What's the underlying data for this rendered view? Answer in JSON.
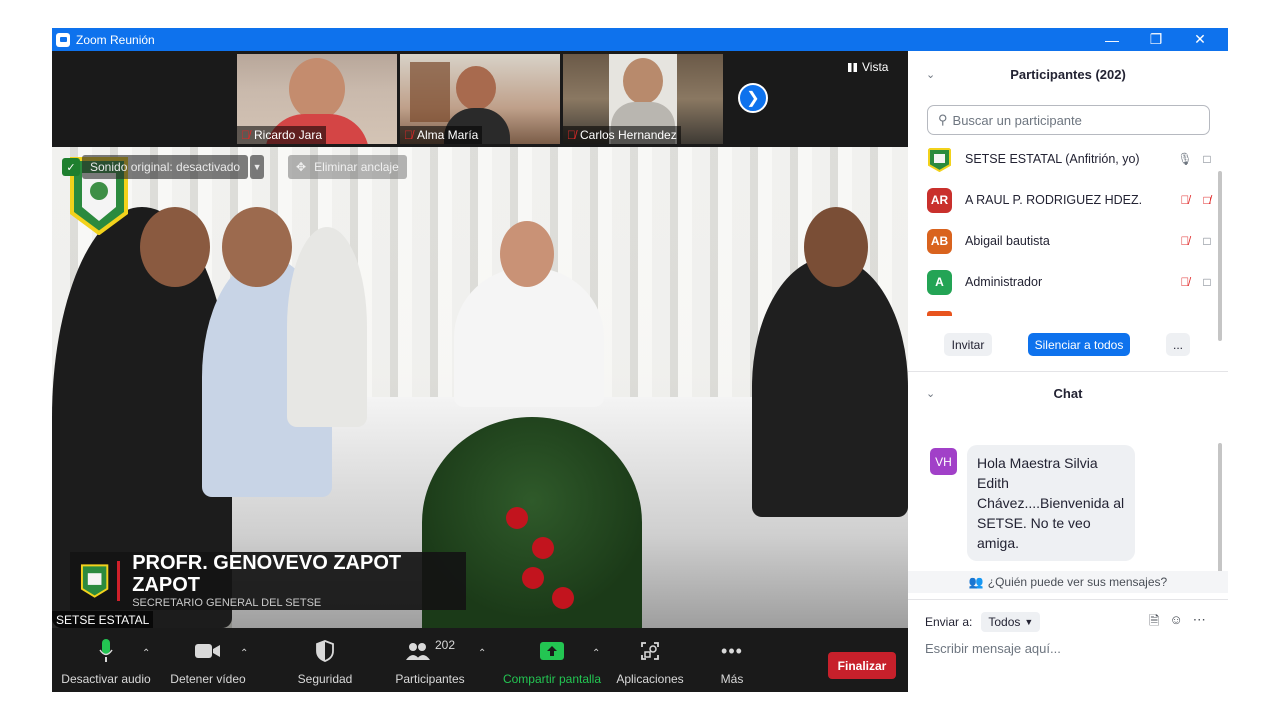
{
  "window": {
    "title": "Zoom Reunión"
  },
  "gallery": {
    "thumbnails": [
      {
        "name": "Ricardo Jara"
      },
      {
        "name": "Alma María"
      },
      {
        "name": "Carlos Hernandez"
      }
    ],
    "view_label": "Vista"
  },
  "main_video": {
    "original_sound": "Sonido original: desactivado",
    "unpin": "Eliminar anclaje",
    "lower_third_name": "PROFR. GENOVEVO ZAPOT ZAPOT",
    "lower_third_role": "SECRETARIO GENERAL DEL SETSE",
    "speaker_label": "SETSE ESTATAL"
  },
  "toolbar": {
    "audio": "Desactivar audio",
    "video": "Detener vídeo",
    "security": "Seguridad",
    "participants": "Participantes",
    "participants_count": "202",
    "share": "Compartir pantalla",
    "apps": "Aplicaciones",
    "more": "Más",
    "end": "Finalizar"
  },
  "participants_panel": {
    "title": "Participantes (202)",
    "search_placeholder": "Buscar un participante",
    "list": [
      {
        "initials": "",
        "name": "SETSE ESTATAL (Anfitrión, yo)",
        "color": "#ffffff"
      },
      {
        "initials": "AR",
        "name": "A RAUL P. RODRIGUEZ HDEZ.",
        "color": "#c9302c"
      },
      {
        "initials": "AB",
        "name": "Abigail bautista",
        "color": "#d9631e"
      },
      {
        "initials": "A",
        "name": "Administrador",
        "color": "#23a455"
      }
    ],
    "invite": "Invitar",
    "mute_all": "Silenciar a todos",
    "more": "..."
  },
  "chat": {
    "title": "Chat",
    "messages": [
      {
        "initials": "VH",
        "text": "Hola Maestra Silvia Edith Chávez....Bienvenida al SETSE. No te veo amiga."
      }
    ],
    "who_can_see": "¿Quién puede ver sus mensajes?",
    "send_to_label": "Enviar a:",
    "send_to_value": "Todos",
    "input_placeholder": "Escribir mensaje aquí..."
  },
  "colors": {
    "zoom_blue": "#0e72ed",
    "end_red": "#c7202b",
    "share_green": "#23c552"
  }
}
